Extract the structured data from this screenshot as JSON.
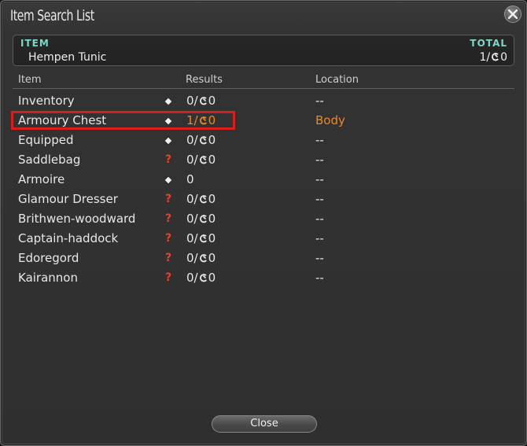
{
  "window": {
    "title": "Item Search List",
    "close_icon": "close-x-icon"
  },
  "header": {
    "item_label": "ITEM",
    "total_label": "TOTAL",
    "item_name": "Hempen Tunic",
    "total_value_nq": "1/",
    "total_value_hq": "0"
  },
  "columns": {
    "item": "Item",
    "results": "Results",
    "location": "Location"
  },
  "rows": [
    {
      "name": "Inventory",
      "marker": "diamond",
      "results_nq": "0/",
      "results_hq": "0",
      "location": "--"
    },
    {
      "name": "Armoury Chest",
      "marker": "diamond",
      "results_nq": "1/",
      "results_hq": "0",
      "location": "Body",
      "highlight": true
    },
    {
      "name": "Equipped",
      "marker": "diamond",
      "results_nq": "0/",
      "results_hq": "0",
      "location": "--"
    },
    {
      "name": "Saddlebag",
      "marker": "question",
      "results_nq": "0/",
      "results_hq": "0",
      "location": "--"
    },
    {
      "name": "Armoire",
      "marker": "diamond",
      "results_nq": "0",
      "results_hq": "",
      "location": "--"
    },
    {
      "name": "Glamour Dresser",
      "marker": "question",
      "results_nq": "0/",
      "results_hq": "0",
      "location": "--"
    },
    {
      "name": "Brithwen-woodward",
      "marker": "question",
      "results_nq": "0/",
      "results_hq": "0",
      "location": "--"
    },
    {
      "name": "Captain-haddock",
      "marker": "question",
      "results_nq": "0/",
      "results_hq": "0",
      "location": "--"
    },
    {
      "name": "Edoregord",
      "marker": "question",
      "results_nq": "0/",
      "results_hq": "0",
      "location": "--"
    },
    {
      "name": "Kairannon",
      "marker": "question",
      "results_nq": "0/",
      "results_hq": "0",
      "location": "--"
    }
  ],
  "question_glyph": "?",
  "footer": {
    "close_label": "Close"
  },
  "colors": {
    "accent_teal": "#7fd6c6",
    "highlight_orange": "#e88a2a",
    "highlight_border": "#d61f1f",
    "question_red": "#e2432d"
  }
}
